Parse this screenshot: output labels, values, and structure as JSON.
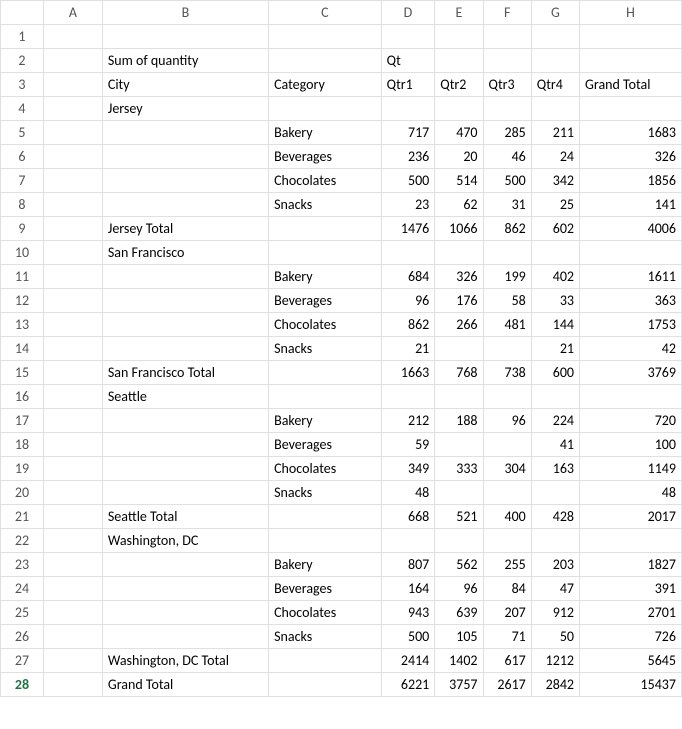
{
  "columns": [
    "A",
    "B",
    "C",
    "D",
    "E",
    "F",
    "G",
    "H"
  ],
  "rows": [
    {
      "n": "1",
      "A": "",
      "B": "",
      "C": "",
      "D": "",
      "E": "",
      "F": "",
      "G": "",
      "H": ""
    },
    {
      "n": "2",
      "A": "",
      "B": "Sum of quantity",
      "C": "",
      "D": "Qt",
      "E": "",
      "F": "",
      "G": "",
      "H": ""
    },
    {
      "n": "3",
      "A": "",
      "B": "City",
      "C": "Category",
      "D": "Qtr1",
      "E": "Qtr2",
      "F": "Qtr3",
      "G": "Qtr4",
      "H": "Grand Total"
    },
    {
      "n": "4",
      "A": "",
      "B": "Jersey",
      "C": "",
      "D": "",
      "E": "",
      "F": "",
      "G": "",
      "H": ""
    },
    {
      "n": "5",
      "A": "",
      "B": "",
      "C": "Bakery",
      "D": "717",
      "E": "470",
      "F": "285",
      "G": "211",
      "H": "1683"
    },
    {
      "n": "6",
      "A": "",
      "B": "",
      "C": "Beverages",
      "D": "236",
      "E": "20",
      "F": "46",
      "G": "24",
      "H": "326"
    },
    {
      "n": "7",
      "A": "",
      "B": "",
      "C": "Chocolates",
      "D": "500",
      "E": "514",
      "F": "500",
      "G": "342",
      "H": "1856"
    },
    {
      "n": "8",
      "A": "",
      "B": "",
      "C": "Snacks",
      "D": "23",
      "E": "62",
      "F": "31",
      "G": "25",
      "H": "141"
    },
    {
      "n": "9",
      "A": "",
      "B": "Jersey Total",
      "C": "",
      "D": "1476",
      "E": "1066",
      "F": "862",
      "G": "602",
      "H": "4006"
    },
    {
      "n": "10",
      "A": "",
      "B": "San Francisco",
      "C": "",
      "D": "",
      "E": "",
      "F": "",
      "G": "",
      "H": ""
    },
    {
      "n": "11",
      "A": "",
      "B": "",
      "C": "Bakery",
      "D": "684",
      "E": "326",
      "F": "199",
      "G": "402",
      "H": "1611"
    },
    {
      "n": "12",
      "A": "",
      "B": "",
      "C": "Beverages",
      "D": "96",
      "E": "176",
      "F": "58",
      "G": "33",
      "H": "363"
    },
    {
      "n": "13",
      "A": "",
      "B": "",
      "C": "Chocolates",
      "D": "862",
      "E": "266",
      "F": "481",
      "G": "144",
      "H": "1753"
    },
    {
      "n": "14",
      "A": "",
      "B": "",
      "C": "Snacks",
      "D": "21",
      "E": "",
      "F": "",
      "G": "21",
      "H": "42"
    },
    {
      "n": "15",
      "A": "",
      "B": "San Francisco Total",
      "C": "",
      "D": "1663",
      "E": "768",
      "F": "738",
      "G": "600",
      "H": "3769"
    },
    {
      "n": "16",
      "A": "",
      "B": "Seattle",
      "C": "",
      "D": "",
      "E": "",
      "F": "",
      "G": "",
      "H": ""
    },
    {
      "n": "17",
      "A": "",
      "B": "",
      "C": "Bakery",
      "D": "212",
      "E": "188",
      "F": "96",
      "G": "224",
      "H": "720"
    },
    {
      "n": "18",
      "A": "",
      "B": "",
      "C": "Beverages",
      "D": "59",
      "E": "",
      "F": "",
      "G": "41",
      "H": "100"
    },
    {
      "n": "19",
      "A": "",
      "B": "",
      "C": "Chocolates",
      "D": "349",
      "E": "333",
      "F": "304",
      "G": "163",
      "H": "1149"
    },
    {
      "n": "20",
      "A": "",
      "B": "",
      "C": "Snacks",
      "D": "48",
      "E": "",
      "F": "",
      "G": "",
      "H": "48"
    },
    {
      "n": "21",
      "A": "",
      "B": "Seattle Total",
      "C": "",
      "D": "668",
      "E": "521",
      "F": "400",
      "G": "428",
      "H": "2017"
    },
    {
      "n": "22",
      "A": "",
      "B": "Washington, DC",
      "C": "",
      "D": "",
      "E": "",
      "F": "",
      "G": "",
      "H": ""
    },
    {
      "n": "23",
      "A": "",
      "B": "",
      "C": "Bakery",
      "D": "807",
      "E": "562",
      "F": "255",
      "G": "203",
      "H": "1827"
    },
    {
      "n": "24",
      "A": "",
      "B": "",
      "C": "Beverages",
      "D": "164",
      "E": "96",
      "F": "84",
      "G": "47",
      "H": "391"
    },
    {
      "n": "25",
      "A": "",
      "B": "",
      "C": "Chocolates",
      "D": "943",
      "E": "639",
      "F": "207",
      "G": "912",
      "H": "2701"
    },
    {
      "n": "26",
      "A": "",
      "B": "",
      "C": "Snacks",
      "D": "500",
      "E": "105",
      "F": "71",
      "G": "50",
      "H": "726"
    },
    {
      "n": "27",
      "A": "",
      "B": "Washington, DC Total",
      "C": "",
      "D": "2414",
      "E": "1402",
      "F": "617",
      "G": "1212",
      "H": "5645"
    },
    {
      "n": "28",
      "A": "",
      "B": "Grand Total",
      "C": "",
      "D": "6221",
      "E": "3757",
      "F": "2617",
      "G": "2842",
      "H": "15437"
    }
  ],
  "selected_row": "28",
  "text_columns": [
    "A",
    "B",
    "C"
  ],
  "text_override_cells": {
    "2": [
      "D"
    ],
    "3": [
      "D",
      "E",
      "F",
      "G",
      "H"
    ]
  }
}
